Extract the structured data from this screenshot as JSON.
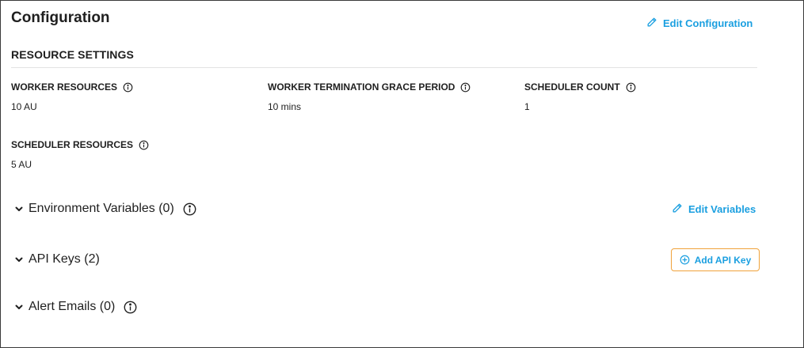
{
  "page": {
    "title": "Configuration",
    "edit_configuration_label": "Edit Configuration"
  },
  "resource_settings": {
    "title": "RESOURCE SETTINGS",
    "fields": [
      {
        "label": "WORKER RESOURCES",
        "value": "10 AU"
      },
      {
        "label": "WORKER TERMINATION GRACE PERIOD",
        "value": "10 mins"
      },
      {
        "label": "SCHEDULER COUNT",
        "value": "1"
      },
      {
        "label": "SCHEDULER RESOURCES",
        "value": "5 AU"
      }
    ]
  },
  "sections": {
    "environment_variables": {
      "label": "Environment Variables (0)",
      "action_label": "Edit Variables"
    },
    "api_keys": {
      "label": "API Keys (2)",
      "action_label": "Add API Key"
    },
    "alert_emails": {
      "label": "Alert Emails (0)"
    }
  },
  "colors": {
    "accent": "#1a9fe0",
    "focus_border": "#f0a23a",
    "text": "#1f1f1f",
    "divider": "#e3e3e3"
  },
  "icons": {
    "edit": "pencil-icon",
    "info": "info-icon",
    "expand": "chevron-down-icon",
    "add": "plus-circle-icon"
  }
}
